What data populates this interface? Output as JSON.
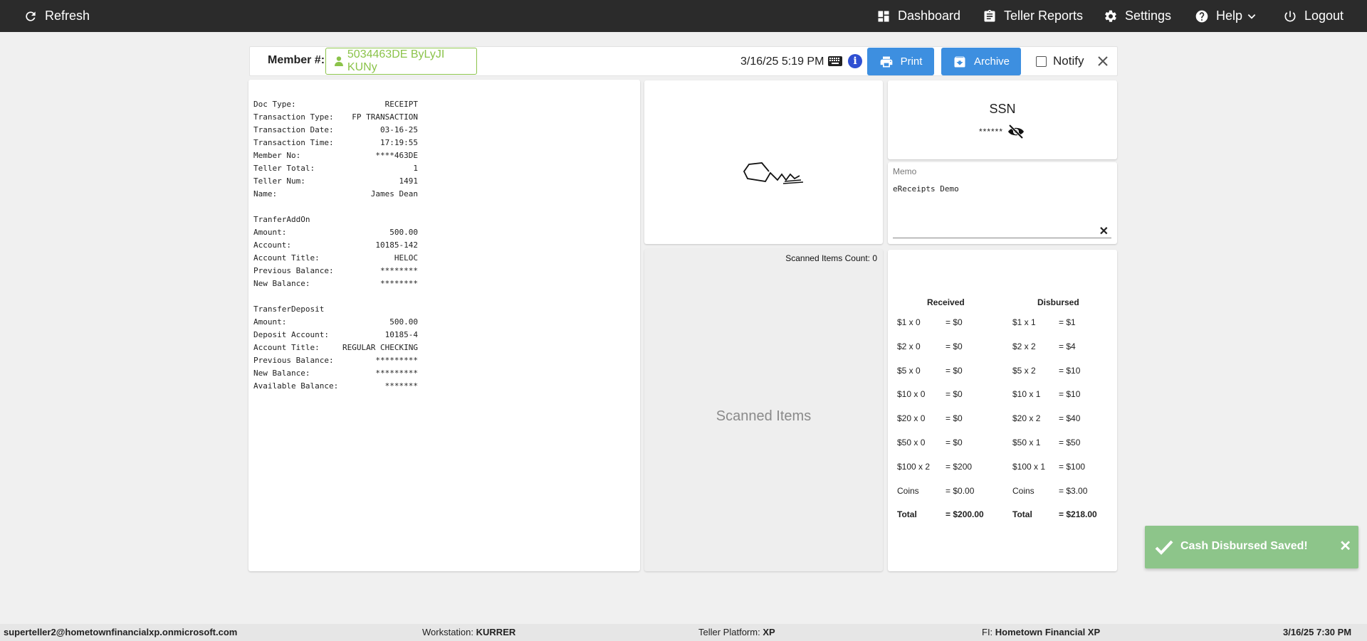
{
  "topnav": {
    "refresh": "Refresh",
    "dashboard": "Dashboard",
    "teller_reports": "Teller Reports",
    "settings": "Settings",
    "help": "Help",
    "logout": "Logout"
  },
  "header": {
    "member_label": "Member #:",
    "member_value": "5034463DE ByLyJI KUNy",
    "datetime": "3/16/25 5:19 PM",
    "print": "Print",
    "archive": "Archive",
    "notify": "Notify"
  },
  "receipt": {
    "lines": [
      {
        "k": "Doc Type:",
        "v": "RECEIPT"
      },
      {
        "k": "Transaction Type:",
        "v": "FP TRANSACTION"
      },
      {
        "k": "Transaction Date:",
        "v": "03-16-25"
      },
      {
        "k": "Transaction Time:",
        "v": "17:19:55"
      },
      {
        "k": "Member No:",
        "v": "****463DE"
      },
      {
        "k": "Teller Total:",
        "v": "1"
      },
      {
        "k": "Teller Num:",
        "v": "1491"
      },
      {
        "k": "Name:",
        "v": "James Dean"
      },
      {
        "k": "",
        "v": ""
      },
      {
        "k": "TranferAddOn",
        "v": ""
      },
      {
        "k": "Amount:",
        "v": "500.00"
      },
      {
        "k": "Account:",
        "v": "10185-142"
      },
      {
        "k": "Account Title:",
        "v": "HELOC"
      },
      {
        "k": "Previous Balance:",
        "v": "********"
      },
      {
        "k": "New Balance:",
        "v": "********"
      },
      {
        "k": "",
        "v": ""
      },
      {
        "k": "TransferDeposit",
        "v": ""
      },
      {
        "k": "Amount:",
        "v": "500.00"
      },
      {
        "k": "Deposit Account:",
        "v": "10185-4"
      },
      {
        "k": "Account Title:",
        "v": "REGULAR CHECKING"
      },
      {
        "k": "Previous Balance:",
        "v": "*********"
      },
      {
        "k": "New Balance:",
        "v": "*********"
      },
      {
        "k": "Available Balance:",
        "v": "*******"
      }
    ]
  },
  "scanned": {
    "count_label": "Scanned Items Count: 0",
    "placeholder": "Scanned Items"
  },
  "ssn": {
    "title": "SSN",
    "masked": "******"
  },
  "memo": {
    "label": "Memo",
    "value": "eReceipts Demo"
  },
  "cash": {
    "received_header": "Received",
    "disbursed_header": "Disbursed",
    "rows": [
      {
        "rl": "$1 x 0",
        "rv": "= $0",
        "dl": "$1 x 1",
        "dv": "= $1"
      },
      {
        "rl": "$2 x 0",
        "rv": "= $0",
        "dl": "$2 x 2",
        "dv": "= $4"
      },
      {
        "rl": "$5 x 0",
        "rv": "= $0",
        "dl": "$5 x 2",
        "dv": "= $10"
      },
      {
        "rl": "$10 x 0",
        "rv": "= $0",
        "dl": "$10 x 1",
        "dv": "= $10"
      },
      {
        "rl": "$20 x 0",
        "rv": "= $0",
        "dl": "$20 x 2",
        "dv": "= $40"
      },
      {
        "rl": "$50 x 0",
        "rv": "= $0",
        "dl": "$50 x 1",
        "dv": "= $50"
      },
      {
        "rl": "$100 x 2",
        "rv": "= $200",
        "dl": "$100 x 1",
        "dv": "= $100"
      },
      {
        "rl": "Coins",
        "rv": "= $0.00",
        "dl": "Coins",
        "dv": "= $3.00"
      },
      {
        "rl": "Total",
        "rv": "= $200.00",
        "dl": "Total",
        "dv": "= $218.00"
      }
    ]
  },
  "toast": {
    "message": "Cash Disbursed Saved!"
  },
  "footer": {
    "user": "superteller2@hometownfinancialxp.onmicrosoft.com",
    "workstation_label": "Workstation:",
    "workstation": "KURRER",
    "platform_label": "Teller Platform:",
    "platform": "XP",
    "fi_label": "FI:",
    "fi": "Hometown Financial XP",
    "datetime": "3/16/25 7:30 PM"
  },
  "colors": {
    "topbar": "#2b2b2b",
    "accent_blue": "#3d8fe0",
    "member_green": "#8bc34a",
    "toast_green": "#8dc58a"
  }
}
